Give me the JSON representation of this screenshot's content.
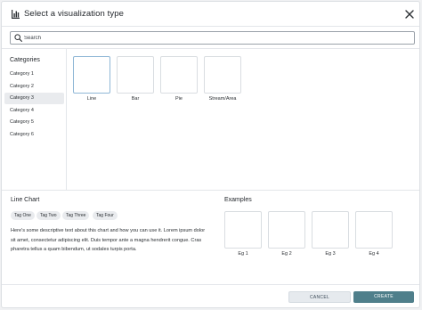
{
  "dialog": {
    "title": "Select a visualization type",
    "icon": "bar-chart-icon",
    "close_icon": "close-icon"
  },
  "search": {
    "placeholder": "Search",
    "value": ""
  },
  "sidebar": {
    "title": "Categories",
    "selected_index": 2,
    "items": [
      {
        "label": "Category 1"
      },
      {
        "label": "Category 2"
      },
      {
        "label": "Category 3"
      },
      {
        "label": "Category 4"
      },
      {
        "label": "Category 5"
      },
      {
        "label": "Category 6"
      }
    ]
  },
  "types": {
    "selected_index": 0,
    "items": [
      {
        "label": "Line"
      },
      {
        "label": "Bar"
      },
      {
        "label": "Pie"
      },
      {
        "label": "Stream/Area"
      }
    ]
  },
  "details": {
    "title": "Line Chart",
    "tags": [
      "Tag One",
      "Tag Two",
      "Tag Three",
      "Tag Four"
    ],
    "description": "Here's some descriptive text about this chart and how you can use it. Lorem ipsum dolor sit amet, consectetur adipiscing elit. Duis tempor ante a magna hendrerit congue. Cras pharetra tellus a quam bibendum, ut sodales turpis porta."
  },
  "examples": {
    "title": "Examples",
    "items": [
      {
        "label": "Eg 1"
      },
      {
        "label": "Eg 2"
      },
      {
        "label": "Eg 3"
      },
      {
        "label": "Eg 4"
      }
    ]
  },
  "footer": {
    "cancel_label": "CANCEL",
    "create_label": "CREATE"
  },
  "colors": {
    "primary": "#4f7f8b",
    "secondary": "#e6eaee",
    "selected_border": "#8fb7d6"
  }
}
